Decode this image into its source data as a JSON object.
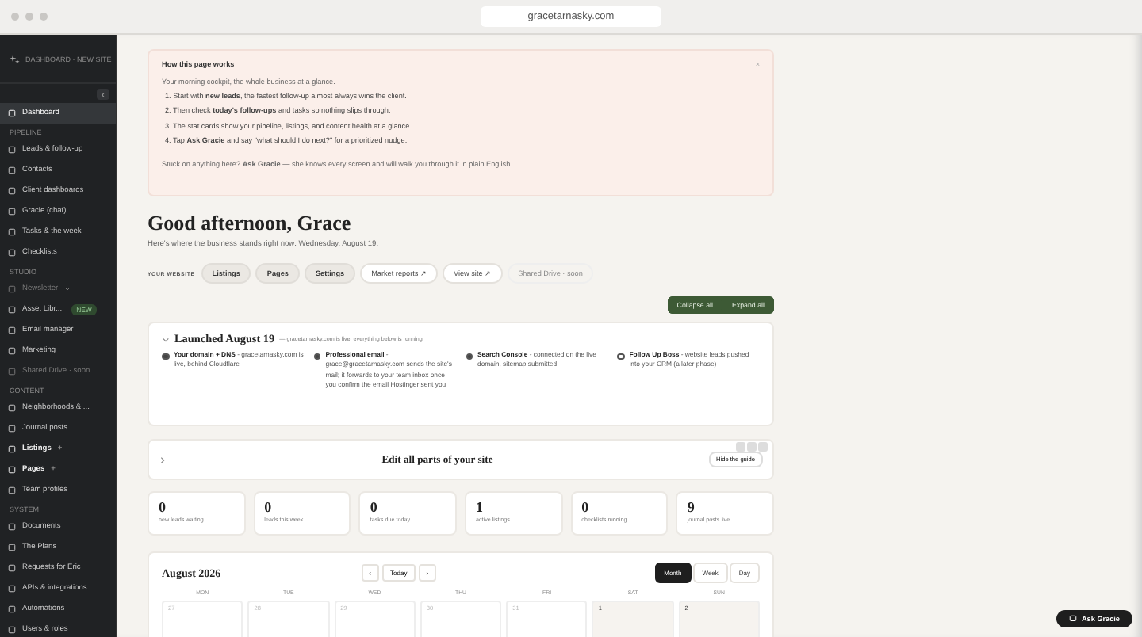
{
  "browser": {
    "url": "gracetarnasky.com"
  },
  "sidebar": {
    "brand": "DASHBOARD · NEW SITE",
    "sections": [
      {
        "items": [
          {
            "label": "Dashboard",
            "selected": true,
            "disabled": false
          }
        ]
      },
      {
        "label": "PIPELINE",
        "items": [
          {
            "label": "Leads & follow-up",
            "selected": false,
            "disabled": false
          },
          {
            "label": "Contacts",
            "selected": false,
            "disabled": false
          },
          {
            "label": "Client dashboards",
            "selected": false,
            "disabled": false
          },
          {
            "label": "Gracie (chat)",
            "selected": false,
            "disabled": false
          },
          {
            "label": "Tasks & the week",
            "selected": false,
            "disabled": false
          },
          {
            "label": "Checklists",
            "selected": false,
            "disabled": false
          }
        ]
      },
      {
        "label": "STUDIO",
        "items": [
          {
            "label": "Newsletter",
            "selected": false,
            "disabled": true,
            "expandable": true
          },
          {
            "label": "Asset Libr...",
            "selected": false,
            "disabled": false,
            "badge": "NEW"
          },
          {
            "label": "Email manager",
            "selected": false,
            "disabled": false
          },
          {
            "label": "Marketing",
            "selected": false,
            "disabled": false
          },
          {
            "label": "Shared Drive · soon",
            "selected": false,
            "disabled": true
          }
        ]
      },
      {
        "label": "CONTENT",
        "items": [
          {
            "label": "Neighborhoods & ...",
            "selected": false,
            "disabled": false
          },
          {
            "label": "Journal posts",
            "selected": false,
            "disabled": false
          },
          {
            "label": "Listings",
            "selected": false,
            "disabled": false,
            "bold": true,
            "suffix": "+"
          },
          {
            "label": "Pages",
            "selected": false,
            "disabled": false,
            "bold": true,
            "suffix": "+"
          },
          {
            "label": "Team profiles",
            "selected": false,
            "disabled": false
          }
        ]
      },
      {
        "label": "SYSTEM",
        "items": [
          {
            "label": "Documents",
            "selected": false,
            "disabled": false
          },
          {
            "label": "The Plans",
            "selected": false,
            "disabled": false
          },
          {
            "label": "Requests for Eric",
            "selected": false,
            "disabled": false
          },
          {
            "label": "APIs & integrations",
            "selected": false,
            "disabled": false
          },
          {
            "label": "Automations",
            "selected": false,
            "disabled": false
          },
          {
            "label": "Users & roles",
            "selected": false,
            "disabled": false
          }
        ]
      }
    ]
  },
  "guide": {
    "title": "How this page works",
    "close": "×",
    "intro": "Your morning cockpit, the whole business at a glance.",
    "steps": [
      "1. Start with **new leads**, the fastest follow-up almost always wins the client.",
      "2. Then check **today's follow-ups** and tasks so nothing slips through.",
      "3. The stat cards show your pipeline, listings, and content health at a glance.",
      "4. Tap **Ask Gracie** and say \"what should I do next?\" for a prioritized nudge."
    ],
    "footer": "Stuck on anything here? **Ask Gracie** — she knows every screen and will walk you through it in plain English."
  },
  "greeting": {
    "title": "Good afternoon, Grace",
    "subtitle": "Here's where the business stands right now: Wednesday, August 19."
  },
  "website": {
    "label": "YOUR WEBSITE",
    "links": [
      {
        "label": "Listings",
        "kind": "internal"
      },
      {
        "label": "Pages",
        "kind": "internal"
      },
      {
        "label": "Settings",
        "kind": "internal"
      },
      {
        "label": "Market reports ↗",
        "kind": "external"
      },
      {
        "label": "View site ↗",
        "kind": "external"
      },
      {
        "label": "Shared Drive · soon",
        "kind": "disabled"
      }
    ]
  },
  "actions": [
    "Collapse all",
    "Expand all"
  ],
  "launch": {
    "title": "Launched August 19",
    "note": "— gracetarnasky.com is live; everything below is running",
    "expanded": true,
    "items": [
      {
        "title": "Your domain + DNS",
        "text": " - gracetarnasky.com is live, behind Cloudflare",
        "done": true
      },
      {
        "title": "Professional email",
        "text": " - grace@gracetarnasky.com sends the site's mail; it forwards to your team inbox once you confirm the email Hostinger sent you",
        "done": true
      },
      {
        "title": "Search Console",
        "text": " - connected on the live domain, sitemap submitted",
        "done": true
      },
      {
        "title": "Follow Up Boss",
        "text": " - website leads pushed into your CRM (a later phase)",
        "done": false
      }
    ]
  },
  "edit_card": {
    "title": "Edit all parts of your site",
    "expanded": false,
    "button": "Hide the guide"
  },
  "stats": [
    {
      "value": "0",
      "label": "new leads waiting"
    },
    {
      "value": "0",
      "label": "leads this week"
    },
    {
      "value": "0",
      "label": "tasks due today"
    },
    {
      "value": "1",
      "label": "active listings"
    },
    {
      "value": "0",
      "label": "checklists running"
    },
    {
      "value": "9",
      "label": "journal posts live"
    }
  ],
  "calendar": {
    "title": "August 2026",
    "prev": "‹",
    "today": "Today",
    "next": "›",
    "views": [
      {
        "label": "Month",
        "selected": true
      },
      {
        "label": "Week",
        "selected": false
      },
      {
        "label": "Day",
        "selected": false
      }
    ],
    "weekdays": [
      "MON",
      "TUE",
      "WED",
      "THU",
      "FRI",
      "SAT",
      "SUN"
    ],
    "days": [
      {
        "date": "27",
        "outside": true
      },
      {
        "date": "28",
        "outside": true
      },
      {
        "date": "29",
        "outside": true
      },
      {
        "date": "30",
        "outside": true
      },
      {
        "date": "31",
        "outside": true
      },
      {
        "date": "1",
        "outside": false
      },
      {
        "date": "2",
        "outside": false
      }
    ]
  },
  "assistant": {
    "label": "Ask Gracie"
  }
}
